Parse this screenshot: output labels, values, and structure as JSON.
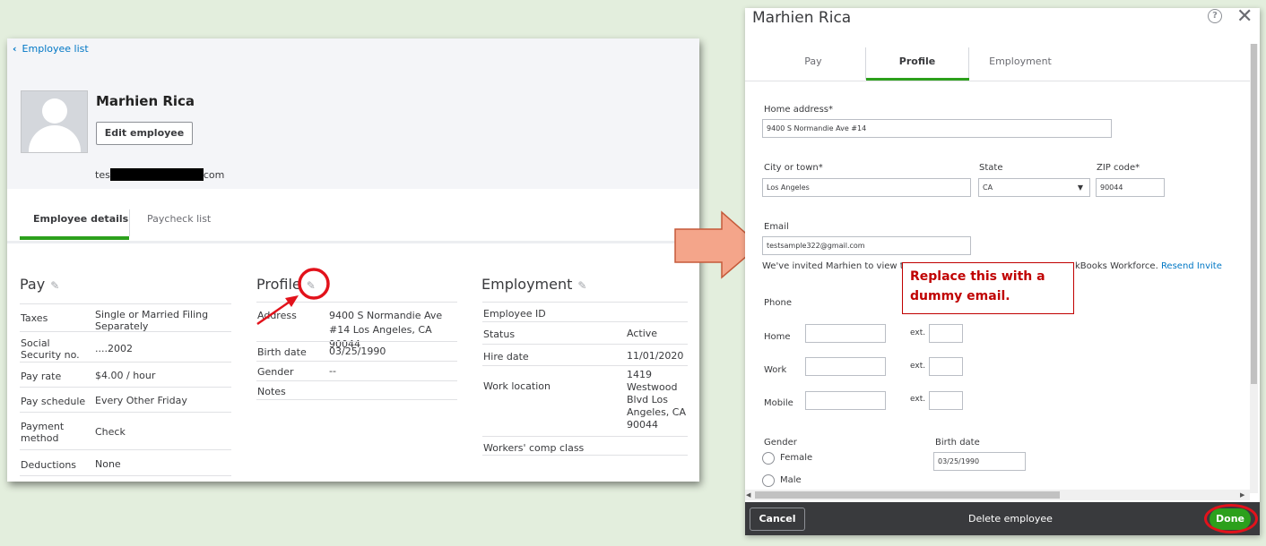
{
  "colors": {
    "accent": "#2ca01c",
    "link": "#0077c5",
    "annotation_red": "#c00000",
    "footer": "#393a3d"
  },
  "left": {
    "back_link": "Employee list",
    "employee_name": "Marhien Rica",
    "edit_button": "Edit employee",
    "email_prefix": "tes",
    "email_suffix": "com",
    "tabs": [
      "Employee details",
      "Paycheck list"
    ],
    "pay": {
      "title": "Pay",
      "rows": [
        {
          "k": "Taxes",
          "v": "Single or Married Filing Separately"
        },
        {
          "k": "Social Security no.",
          "v": "....2002"
        },
        {
          "k": "Pay rate",
          "v": "$4.00 / hour"
        },
        {
          "k": "Pay schedule",
          "v": "Every Other Friday"
        },
        {
          "k": "Payment method",
          "v": "Check"
        },
        {
          "k": "Deductions",
          "v": "None"
        }
      ]
    },
    "profile": {
      "title": "Profile",
      "rows": [
        {
          "k": "Address",
          "v": "9400 S Normandie Ave #14 Los Angeles, CA 90044"
        },
        {
          "k": "Birth date",
          "v": "03/25/1990"
        },
        {
          "k": "Gender",
          "v": "--"
        },
        {
          "k": "Notes",
          "v": ""
        }
      ]
    },
    "employment": {
      "title": "Employment",
      "rows": [
        {
          "k": "Employee ID",
          "v": ""
        },
        {
          "k": "Status",
          "v": "Active"
        },
        {
          "k": "Hire date",
          "v": "11/01/2020"
        },
        {
          "k": "Work location",
          "v": "1419 Westwood Blvd Los Angeles, CA 90044"
        },
        {
          "k": "Workers' comp class",
          "v": ""
        }
      ]
    }
  },
  "right": {
    "title": "Marhien Rica",
    "help_icon": "?",
    "close_icon": "✕",
    "tabs": [
      "Pay",
      "Profile",
      "Employment"
    ],
    "home_address_label": "Home address*",
    "home_address_value": "9400 S Normandie Ave #14",
    "city_label": "City or town*",
    "city_value": "Los Angeles",
    "state_label": "State",
    "state_value": "CA",
    "zip_label": "ZIP code*",
    "zip_value": "90044",
    "email_label": "Email",
    "email_value": "testsample322@gmail.com",
    "invite_prefix": "We've invited Marhien to view t",
    "invite_suffix": "kBooks Workforce.",
    "resend_link": "Resend Invite",
    "phone_label": "Phone",
    "phone_rows": [
      "Home",
      "Work",
      "Mobile"
    ],
    "ext_label": "ext.",
    "gender_label": "Gender",
    "gender_options": [
      "Female",
      "Male"
    ],
    "birth_date_label": "Birth date",
    "birth_date_value": "03/25/1990",
    "cancel": "Cancel",
    "delete": "Delete employee",
    "done": "Done"
  },
  "annotation": {
    "callout_text": "Replace this with a dummy email."
  }
}
